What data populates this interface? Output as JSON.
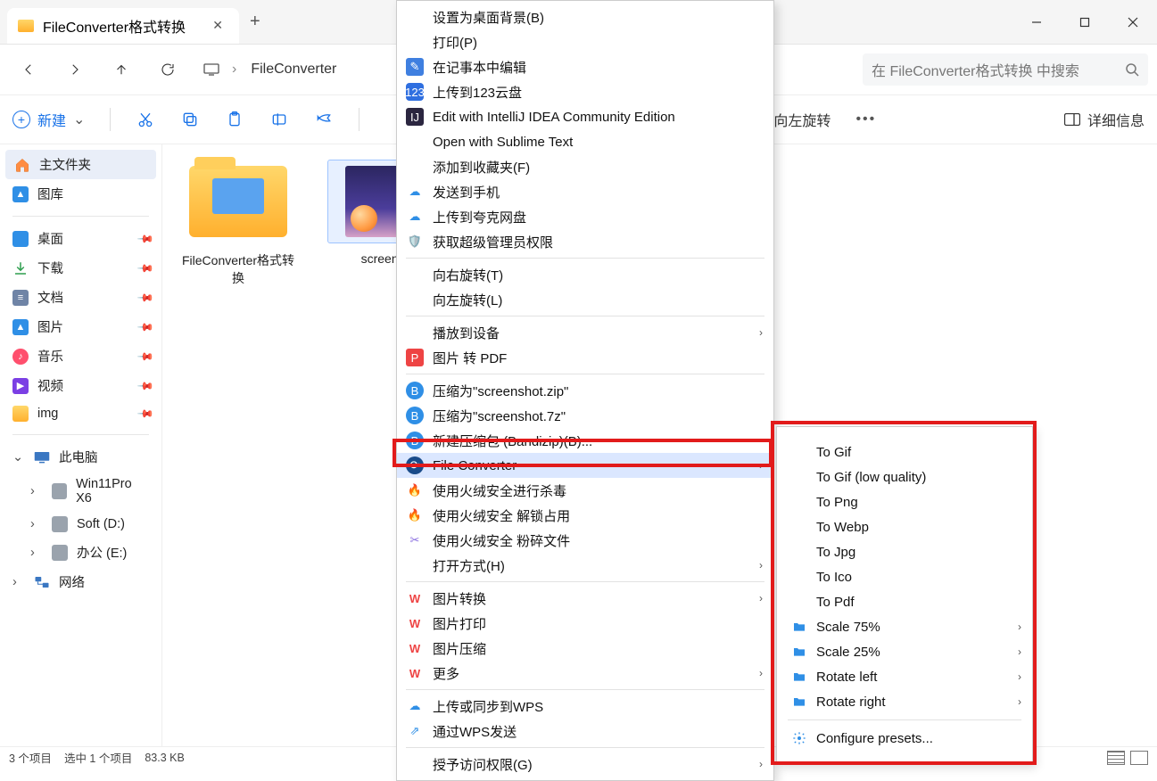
{
  "tab": {
    "title": "FileConverter格式转换"
  },
  "breadcrumb": {
    "seg1": "FileConverter"
  },
  "search": {
    "placeholder": "在 FileConverter格式转换 中搜索"
  },
  "toolbar": {
    "new_label": "新建",
    "rotate_left": "向左旋转",
    "details": "详细信息"
  },
  "sidebar": {
    "home": "主文件夹",
    "gallery": "图库",
    "desktop": "桌面",
    "downloads": "下载",
    "documents": "文档",
    "pictures": "图片",
    "music": "音乐",
    "videos": "视频",
    "img_folder": "img",
    "this_pc": "此电脑",
    "drive1": "Win11Pro X6",
    "drive2": "Soft (D:)",
    "drive3": "办公 (E:)",
    "network": "网络"
  },
  "files": {
    "folder_name": "FileConverter格式转换",
    "image_name": "screensh"
  },
  "status": {
    "count": "3 个项目",
    "selected": "选中 1 个项目",
    "size": "83.3 KB"
  },
  "context_menu": {
    "set_wallpaper": "设置为桌面背景(B)",
    "print": "打印(P)",
    "notepad_edit": "在记事本中编辑",
    "upload_123": "上传到123云盘",
    "edit_intellij": "Edit with IntelliJ IDEA Community Edition",
    "open_sublime": "Open with Sublime Text",
    "add_favorites": "添加到收藏夹(F)",
    "send_phone": "发送到手机",
    "upload_quark": "上传到夸克网盘",
    "admin_rights": "获取超级管理员权限",
    "rotate_right": "向右旋转(T)",
    "rotate_left": "向左旋转(L)",
    "play_to_device": "播放到设备",
    "image_to_pdf": "图片 转 PDF",
    "compress_zip": "压缩为\"screenshot.zip\"",
    "compress_7z": "压缩为\"screenshot.7z\"",
    "new_archive": "新建压缩包 (Bandizip)(B)...",
    "file_converter": "File Converter",
    "huorong_scan": "使用火绒安全进行杀毒",
    "huorong_unlock": "使用火绒安全 解锁占用",
    "huorong_shred": "使用火绒安全 粉碎文件",
    "open_with": "打开方式(H)",
    "wps_img_convert": "图片转换",
    "wps_img_print": "图片打印",
    "wps_img_compress": "图片压缩",
    "wps_more": "更多",
    "wps_upload_sync": "上传或同步到WPS",
    "wps_send": "通过WPS发送",
    "grant_access": "授予访问权限(G)"
  },
  "submenu": {
    "to_gif": "To Gif",
    "to_gif_low": "To Gif (low quality)",
    "to_png": "To Png",
    "to_webp": "To Webp",
    "to_jpg": "To Jpg",
    "to_ico": "To Ico",
    "to_pdf": "To Pdf",
    "scale_75": "Scale 75%",
    "scale_25": "Scale 25%",
    "rotate_left": "Rotate left",
    "rotate_right": "Rotate right",
    "configure": "Configure presets..."
  }
}
